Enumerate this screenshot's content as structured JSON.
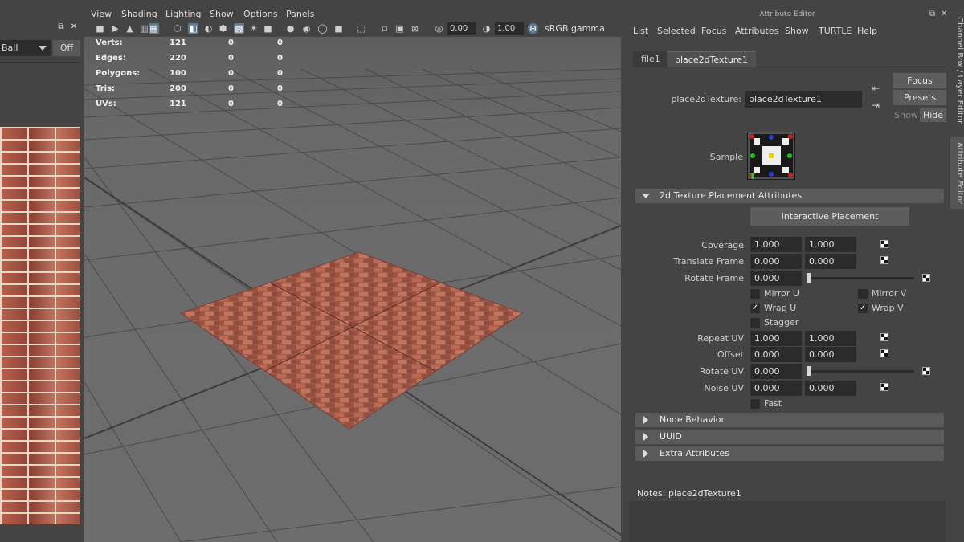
{
  "left_panel": {
    "field_value": "Ball",
    "off_button": "Off"
  },
  "viewport": {
    "menu": [
      "View",
      "Shading",
      "Lighting",
      "Show",
      "Options",
      "Panels"
    ],
    "toolbar": {
      "exposure_value": "0.00",
      "gamma_value": "1.00",
      "color_space": "sRGB gamma"
    },
    "hud": {
      "rows": [
        {
          "label": "Verts:",
          "values": [
            "121",
            "0",
            "0"
          ]
        },
        {
          "label": "Edges:",
          "values": [
            "220",
            "0",
            "0"
          ]
        },
        {
          "label": "Polygons:",
          "values": [
            "100",
            "0",
            "0"
          ]
        },
        {
          "label": "Tris:",
          "values": [
            "200",
            "0",
            "0"
          ]
        },
        {
          "label": "UVs:",
          "values": [
            "121",
            "0",
            "0"
          ]
        }
      ]
    }
  },
  "attribute_editor": {
    "title": "Attribute Editor",
    "menu": [
      "List",
      "Selected",
      "Focus",
      "Attributes",
      "Show",
      "TURTLE",
      "Help"
    ],
    "tabs": [
      "file1",
      "place2dTexture1"
    ],
    "active_tab": "place2dTexture1",
    "node_label": "place2dTexture:",
    "node_name": "place2dTexture1",
    "focus_button": "Focus",
    "presets_button": "Presets",
    "show_label": "Show",
    "hide_button": "Hide",
    "sample_label": "Sample",
    "section_title": "2d Texture Placement Attributes",
    "interactive_placement": "Interactive Placement",
    "attributes": {
      "coverage": {
        "label": "Coverage",
        "u": "1.000",
        "v": "1.000"
      },
      "translate_frame": {
        "label": "Translate Frame",
        "u": "0.000",
        "v": "0.000"
      },
      "rotate_frame": {
        "label": "Rotate Frame",
        "value": "0.000"
      },
      "repeat_uv": {
        "label": "Repeat UV",
        "u": "1.000",
        "v": "1.000"
      },
      "offset": {
        "label": "Offset",
        "u": "0.000",
        "v": "0.000"
      },
      "rotate_uv": {
        "label": "Rotate UV",
        "value": "0.000"
      },
      "noise_uv": {
        "label": "Noise UV",
        "u": "0.000",
        "v": "0.000"
      }
    },
    "checkboxes": {
      "mirror_u": {
        "label": "Mirror U",
        "checked": false
      },
      "mirror_v": {
        "label": "Mirror V",
        "checked": false
      },
      "wrap_u": {
        "label": "Wrap U",
        "checked": true
      },
      "wrap_v": {
        "label": "Wrap V",
        "checked": true
      },
      "stagger": {
        "label": "Stagger",
        "checked": false
      },
      "fast": {
        "label": "Fast",
        "checked": false
      }
    },
    "collapsed_sections": [
      "Node Behavior",
      "UUID",
      "Extra Attributes"
    ],
    "notes_label": "Notes:  place2dTexture1"
  },
  "side_tabs": [
    "Channel Box / Layer Editor",
    "Attribute Editor"
  ],
  "colors": {
    "panel_bg": "#444444",
    "viewport_bg": "#6b6b6b",
    "field_bg": "#2b2b2b",
    "active_icon": "#5d7a93",
    "brick": "#a8584a"
  }
}
